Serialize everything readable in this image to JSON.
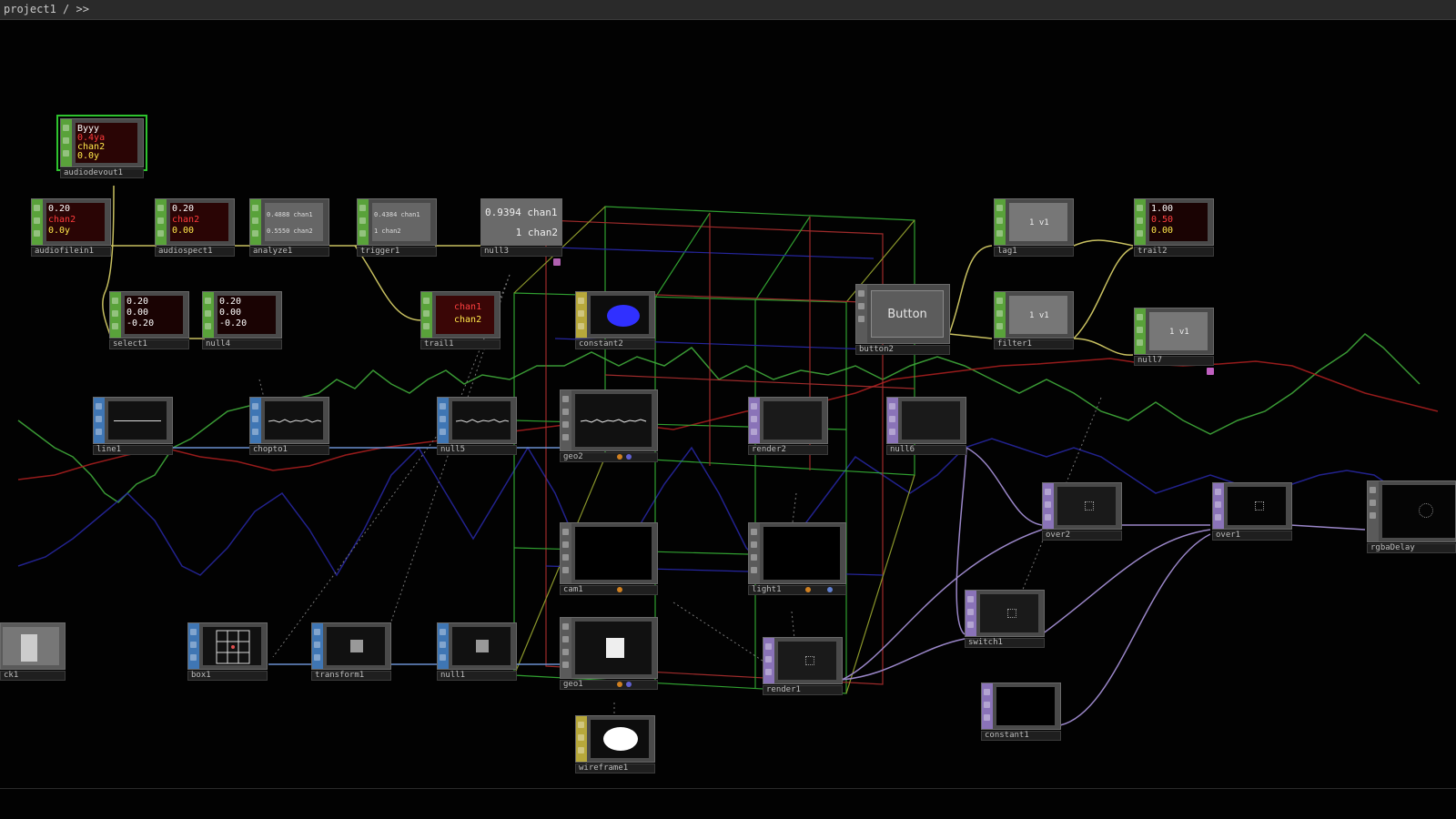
{
  "header": {
    "breadcrumb": "project1 / >>"
  },
  "colors": {
    "chop": "#59a23a",
    "top": "#8a73b8",
    "sop": "#3f76b4",
    "comp": "#5a5a5a",
    "mat": "#b7a83b"
  },
  "nodes": {
    "audiodevout1": {
      "name": "audiodevout1",
      "readout": [
        "Byyy",
        "0.4ya",
        "chan2",
        "0.0y"
      ]
    },
    "audiofilein1": {
      "name": "audiofilein1",
      "readout": [
        "0.20",
        "chan2",
        "0.0y"
      ]
    },
    "audiospect1": {
      "name": "audiospect1",
      "readout": [
        "0.20",
        "chan2",
        "0.00"
      ]
    },
    "analyze1": {
      "name": "analyze1",
      "readout": [
        "0.4888 chan1",
        "0.5550 chan2"
      ]
    },
    "trigger1": {
      "name": "trigger1",
      "readout": [
        "0.4384 chan1",
        "1 chan2"
      ]
    },
    "null3": {
      "name": "null3",
      "readout": [
        "0.9394 chan1",
        "1 chan2"
      ]
    },
    "select1": {
      "name": "select1",
      "readout": [
        "0.20",
        "0.00",
        "-0.20"
      ]
    },
    "null4": {
      "name": "null4",
      "readout": [
        "0.20",
        "0.00",
        "-0.20"
      ]
    },
    "trail1": {
      "name": "trail1",
      "readout": [
        "chan1",
        "chan2"
      ]
    },
    "constant2": {
      "name": "constant2"
    },
    "button2": {
      "name": "button2",
      "label": "Button"
    },
    "lag1": {
      "name": "lag1",
      "readout": [
        "1 v1"
      ]
    },
    "filter1": {
      "name": "filter1",
      "readout": [
        "1 v1"
      ]
    },
    "trail2": {
      "name": "trail2",
      "readout": [
        "1.00",
        "0.50",
        "0.00"
      ]
    },
    "null7": {
      "name": "null7",
      "readout": [
        "1 v1"
      ]
    },
    "line1": {
      "name": "line1"
    },
    "chopto1": {
      "name": "chopto1"
    },
    "null5": {
      "name": "null5"
    },
    "geo2": {
      "name": "geo2"
    },
    "render2": {
      "name": "render2"
    },
    "null6": {
      "name": "null6"
    },
    "over2": {
      "name": "over2"
    },
    "over1": {
      "name": "over1"
    },
    "rgbaDelay": {
      "name": "rgbaDelay"
    },
    "cam1": {
      "name": "cam1"
    },
    "light1": {
      "name": "light1"
    },
    "switch1": {
      "name": "switch1"
    },
    "lock1": {
      "name": "ck1"
    },
    "box1": {
      "name": "box1"
    },
    "transform1": {
      "name": "transform1"
    },
    "null1": {
      "name": "null1"
    },
    "geo1": {
      "name": "geo1"
    },
    "render1": {
      "name": "render1"
    },
    "constant1": {
      "name": "constant1"
    },
    "wireframe1": {
      "name": "wireframe1"
    }
  }
}
